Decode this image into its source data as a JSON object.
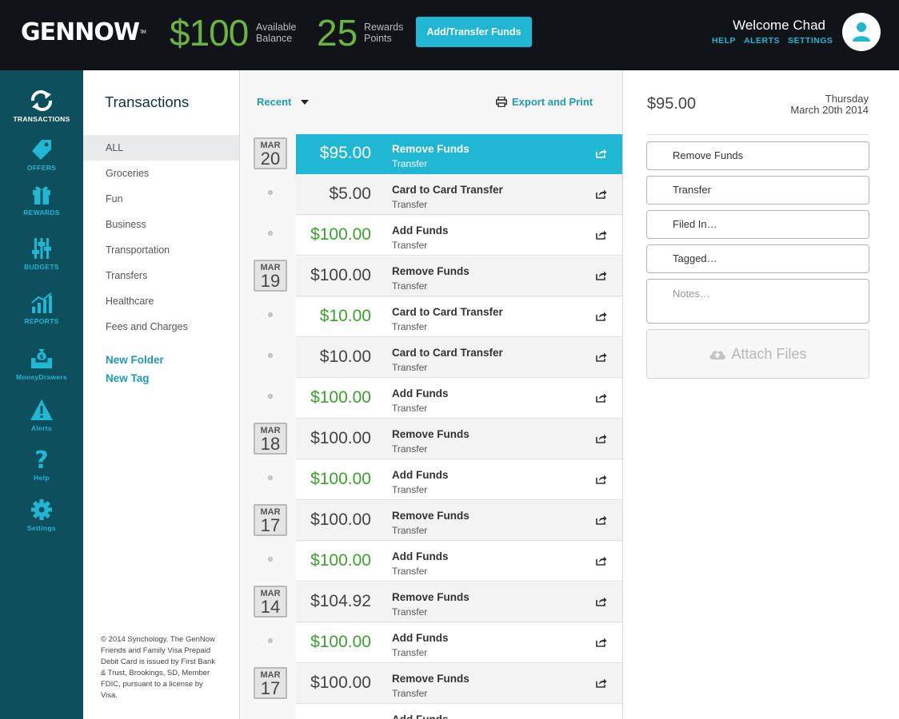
{
  "header": {
    "logo": "GENNOW",
    "logo_tm": "TM",
    "balance_amount": "$100",
    "balance_label": "Available Balance",
    "points_amount": "25",
    "points_label": "Rewards Points",
    "add_button": "Add/Transfer Funds",
    "welcome": "Welcome Chad",
    "links": [
      "HELP",
      "ALERTS",
      "SETTINGS"
    ]
  },
  "nav": {
    "items": [
      {
        "label": "TRANSACTIONS",
        "icon": "transactions-icon"
      },
      {
        "label": "OFFERS",
        "icon": "tag-icon"
      },
      {
        "label": "REWARDS",
        "icon": "gift-icon"
      },
      {
        "label": "BUDGETS",
        "icon": "sliders-icon"
      },
      {
        "label": "REPORTS",
        "icon": "bar-chart-icon"
      },
      {
        "label": "MoneyDrawers",
        "icon": "money-bag-icon"
      },
      {
        "label": "Alerts",
        "icon": "warning-icon"
      },
      {
        "label": "Help",
        "icon": "question-icon"
      },
      {
        "label": "Settings",
        "icon": "gear-icon"
      }
    ]
  },
  "categories": {
    "title": "Transactions",
    "items": [
      "ALL",
      "Groceries",
      "Fun",
      "Business",
      "Transportation",
      "Transfers",
      "Healthcare",
      "Fees and Charges"
    ],
    "new_folder": "New Folder",
    "new_tag": "New Tag",
    "footer": "© 2014 Synchology. The GenNow Friends and Family Visa Prepaid Debit Card is issued by First Bank & Trust, Brookings, SD, Member FDIC, pursuant to a license by Visa."
  },
  "list": {
    "filter_label": "Recent",
    "export_label": "Export and Print",
    "transactions": [
      {
        "amount": "$95.00",
        "title": "Remove Funds",
        "subtitle": "Transfer",
        "month": "MAR",
        "day": "20",
        "positive": false,
        "selected": true
      },
      {
        "amount": "$5.00",
        "title": "Card to Card Transfer",
        "subtitle": "Transfer",
        "positive": false
      },
      {
        "amount": "$100.00",
        "title": "Add Funds",
        "subtitle": "Transfer",
        "positive": true
      },
      {
        "amount": "$100.00",
        "title": "Remove Funds",
        "subtitle": "Transfer",
        "month": "MAR",
        "day": "19",
        "positive": false
      },
      {
        "amount": "$10.00",
        "title": "Card to Card Transfer",
        "subtitle": "Transfer",
        "positive": true
      },
      {
        "amount": "$10.00",
        "title": "Card to Card Transfer",
        "subtitle": "Transfer",
        "positive": false
      },
      {
        "amount": "$100.00",
        "title": "Add Funds",
        "subtitle": "Transfer",
        "positive": true
      },
      {
        "amount": "$100.00",
        "title": "Remove Funds",
        "subtitle": "Transfer",
        "month": "MAR",
        "day": "18",
        "positive": false
      },
      {
        "amount": "$100.00",
        "title": "Add Funds",
        "subtitle": "Transfer",
        "positive": true
      },
      {
        "amount": "$100.00",
        "title": "Remove Funds",
        "subtitle": "Transfer",
        "month": "MAR",
        "day": "17",
        "positive": false
      },
      {
        "amount": "$100.00",
        "title": "Add Funds",
        "subtitle": "Transfer",
        "positive": true
      },
      {
        "amount": "$104.92",
        "title": "Remove Funds",
        "subtitle": "Transfer",
        "month": "MAR",
        "day": "14",
        "positive": false
      },
      {
        "amount": "$100.00",
        "title": "Add Funds",
        "subtitle": "Transfer",
        "positive": true
      },
      {
        "amount": "$100.00",
        "title": "Remove Funds",
        "subtitle": "Transfer",
        "month": "MAR",
        "day": "17",
        "positive": false
      },
      {
        "amount": "",
        "title": "Add Funds",
        "subtitle": "",
        "positive": true
      }
    ]
  },
  "details": {
    "amount": "$95.00",
    "weekday": "Thursday",
    "date": "March 20th 2014",
    "fields": [
      "Remove Funds",
      "Transfer",
      "Filed In…",
      "Tagged…"
    ],
    "notes_placeholder": "Notes…",
    "attach_label": "Attach Files"
  },
  "colors": {
    "accent": "#1fb7d4",
    "nav_bg": "#0d4f5c",
    "header_bg": "#101418",
    "positive": "#3aa12b"
  }
}
